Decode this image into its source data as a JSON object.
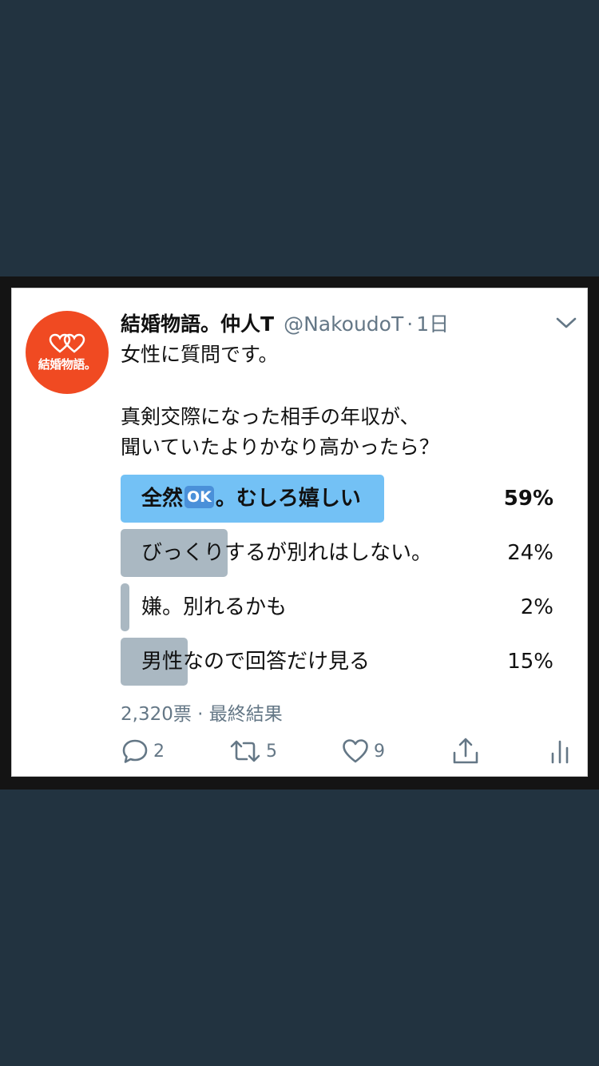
{
  "tweet": {
    "avatar_text": "結婚物語。",
    "display_name": "結婚物語。仲人T",
    "handle": "@NakoudoT",
    "separator": "·",
    "time": "1日",
    "line1": "女性に質問です。",
    "line2": "真剣交際になった相手の年収が、",
    "line3": "聞いていたよりかなり高かったら？"
  },
  "poll": {
    "options": [
      {
        "label_before": "全然",
        "label_badge": "OK",
        "label_after": "。むしろ嬉しい",
        "percent_text": "59%",
        "percent": 59,
        "winner": true
      },
      {
        "label": "びっくりするが別れはしない。",
        "percent_text": "24%",
        "percent": 24,
        "winner": false
      },
      {
        "label": "嫌。別れるかも",
        "percent_text": "2%",
        "percent": 2,
        "winner": false
      },
      {
        "label": "男性なので回答だけ見る",
        "percent_text": "15%",
        "percent": 15,
        "winner": false
      }
    ],
    "summary": "2,320票 · 最終結果"
  },
  "actions": {
    "reply_count": "2",
    "retweet_count": "5",
    "like_count": "9"
  },
  "colors": {
    "page_bg": "#223340",
    "winner_bar": "#73c1f5",
    "other_bar": "#aab8c2",
    "avatar_bg": "#f04a22",
    "secondary_text": "#647786"
  }
}
